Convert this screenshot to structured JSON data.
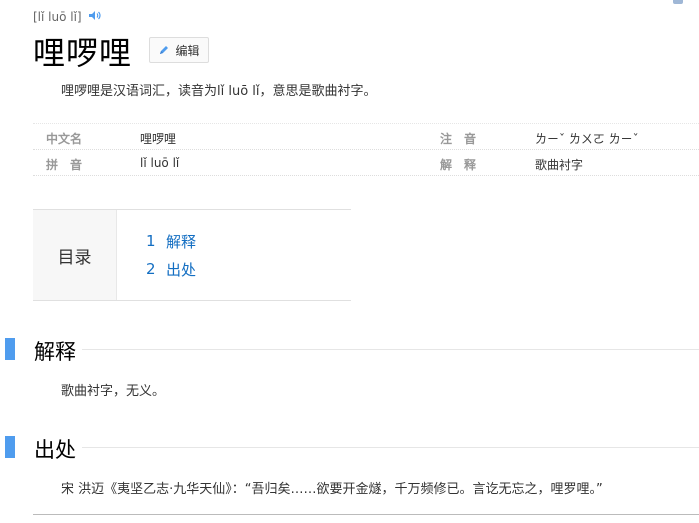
{
  "header": {
    "pinyin": "[lǐ luō lǐ]",
    "title": "哩啰哩",
    "edit_label": "编辑"
  },
  "summary": "哩啰哩是汉语词汇，读音为lǐ luō lǐ，意思是歌曲衬字。",
  "info": {
    "row1": {
      "label1": "中文名",
      "value1": "哩啰哩",
      "label2": "注　音",
      "value2": "ㄌㄧˇ ㄌㄨㄛ ㄌㄧˇ"
    },
    "row2": {
      "label1": "拼　音",
      "value1": "lǐ luō lǐ",
      "label2": "解　释",
      "value2": "歌曲衬字"
    }
  },
  "toc": {
    "heading": "目录",
    "items": [
      {
        "num": "1",
        "label": "解释"
      },
      {
        "num": "2",
        "label": "出处"
      }
    ]
  },
  "sections": {
    "explanation": {
      "title": "解释",
      "text": "歌曲衬字，无义。"
    },
    "source": {
      "title": "出处",
      "text": "宋 洪迈《夷坚乙志·九华天仙》：“吾归矣……欲要开金燧，千万频修已。言讫无忘之，哩罗哩。”"
    }
  },
  "colors": {
    "accent_bar": "#4f9cee",
    "link": "#136ec2"
  },
  "icons": {
    "speaker": "speaker-icon",
    "edit": "pencil-icon"
  }
}
